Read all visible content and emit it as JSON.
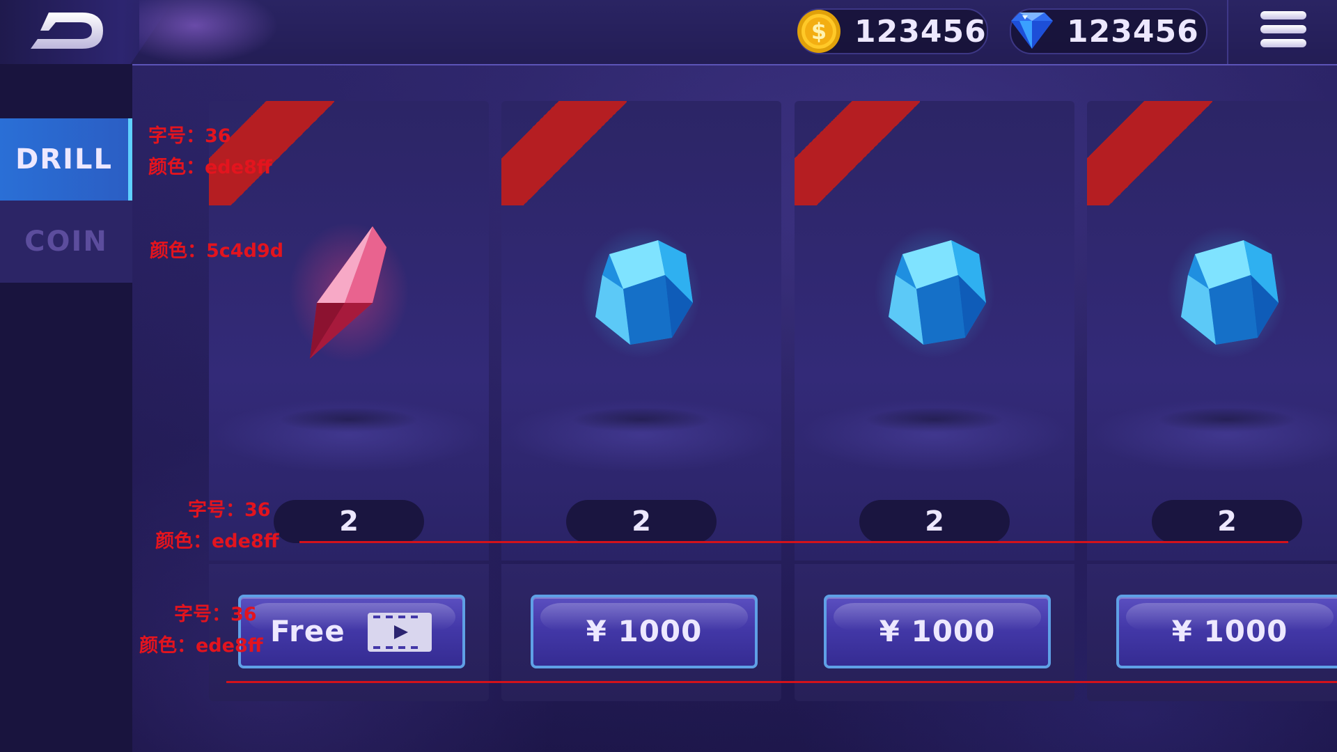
{
  "currency": {
    "coins": "123456",
    "gems": "123456"
  },
  "sidebar": {
    "tabs": [
      {
        "label": "DRILL",
        "active": true
      },
      {
        "label": "COIN",
        "active": false
      }
    ]
  },
  "cards": [
    {
      "item": "red-crystal",
      "quantity": "2",
      "price_label": "Free"
    },
    {
      "item": "blue-gem",
      "quantity": "2",
      "price_label": "¥ 1000"
    },
    {
      "item": "blue-gem",
      "quantity": "2",
      "price_label": "¥ 1000"
    },
    {
      "item": "blue-gem",
      "quantity": "2",
      "price_label": "¥ 1000"
    }
  ],
  "annotations": {
    "tab_size": "字号：36",
    "tab_color": "颜色：ede8ff",
    "inactive_color": "颜色：5c4d9d",
    "qty_size": "字号：36",
    "qty_color": "颜色：ede8ff",
    "btn_size": "字号：36",
    "btn_color": "颜色：ede8ff"
  },
  "colors": {
    "text": "#ede8ff",
    "inactive_text": "#5c4d9d",
    "ribbon": "#b51e22",
    "active_tab": "#2a6fd6",
    "annotation": "#e3141e"
  }
}
